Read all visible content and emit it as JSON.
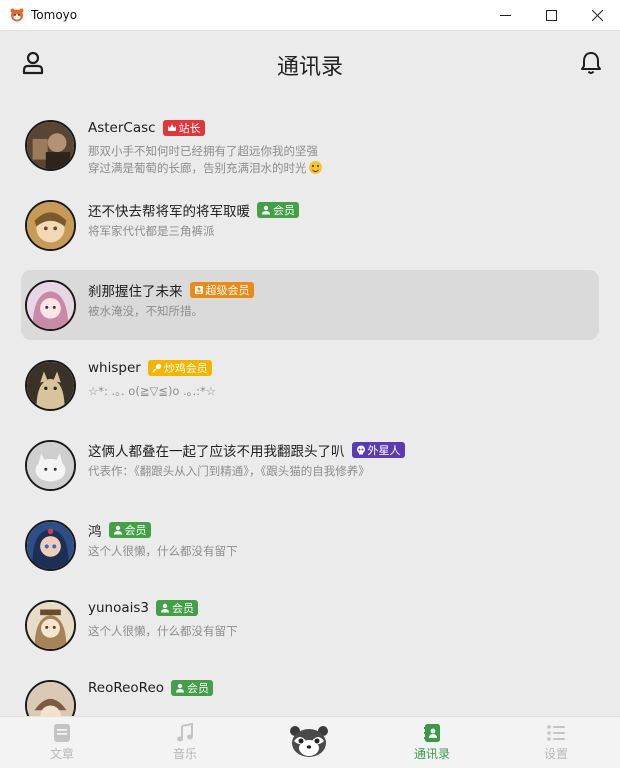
{
  "window": {
    "title": "Tomoyo",
    "icon": "red-panda-app-icon",
    "controls": [
      "minimize-icon",
      "maximize-icon",
      "close-icon"
    ]
  },
  "header": {
    "title": "通讯录",
    "left_icon": "user-profile-icon",
    "right_icon": "bell-icon"
  },
  "contacts": [
    {
      "name": "AsterCasc",
      "badge": {
        "label": "站长",
        "color": "#e0373c",
        "icon": "crown-icon"
      },
      "signature": [
        "那双小手不知何时已经拥有了超远你我的坚强",
        "穿过满是葡萄的长廊，告别充满泪水的时光"
      ],
      "emoji": "grinning-face",
      "selected": false
    },
    {
      "name": "还不快去帮将军的将军取暖",
      "badge": {
        "label": "会员",
        "color": "#43a047",
        "icon": "member-icon"
      },
      "signature": [
        "将军家代代都是三角裤派"
      ],
      "selected": false
    },
    {
      "name": "刹那握住了未来",
      "badge": {
        "label": "超级会员",
        "color": "#ea8a17",
        "icon": "vip-icon"
      },
      "signature": [
        "被水淹没，不知所措。"
      ],
      "selected": true
    },
    {
      "name": "whisper",
      "badge": {
        "label": "炒鸡会员",
        "color": "#f5b400",
        "icon": "drumstick-icon"
      },
      "signature": [
        "☆*: .｡. o(≧▽≦)o .｡.:*☆"
      ],
      "selected": false
    },
    {
      "name": "这俩人都叠在一起了应该不用我翻跟头了叭",
      "badge": {
        "label": "外星人",
        "color": "#5b3bb3",
        "icon": "skull-icon"
      },
      "signature": [
        "代表作：《翻跟头从入门到精通》，《跟头猫的自我修养》"
      ],
      "selected": false
    },
    {
      "name": "鸿",
      "badge": {
        "label": "会员",
        "color": "#43a047",
        "icon": "member-icon"
      },
      "signature": [
        "这个人很懒，什么都没有留下"
      ],
      "selected": false
    },
    {
      "name": "yunoais3",
      "badge": {
        "label": "会员",
        "color": "#43a047",
        "icon": "member-icon"
      },
      "signature": [
        "这个人很懒，什么都没有留下"
      ],
      "selected": false
    },
    {
      "name": "ReoReoReo",
      "badge": {
        "label": "会员",
        "color": "#43a047",
        "icon": "member-icon"
      },
      "signature": [],
      "selected": false
    }
  ],
  "bottom_nav": {
    "items": [
      {
        "label": "文章",
        "icon": "article-icon",
        "active": false
      },
      {
        "label": "音乐",
        "icon": "music-note-icon",
        "active": false
      },
      {
        "label": "",
        "icon": "red-panda-logo",
        "active": false
      },
      {
        "label": "通讯录",
        "icon": "contacts-book-icon",
        "active": true
      },
      {
        "label": "设置",
        "icon": "settings-list-icon",
        "active": false
      }
    ]
  },
  "colors": {
    "accent": "#3a9a47",
    "inactive": "#b8b8b8",
    "selected_row": "#dadada"
  }
}
